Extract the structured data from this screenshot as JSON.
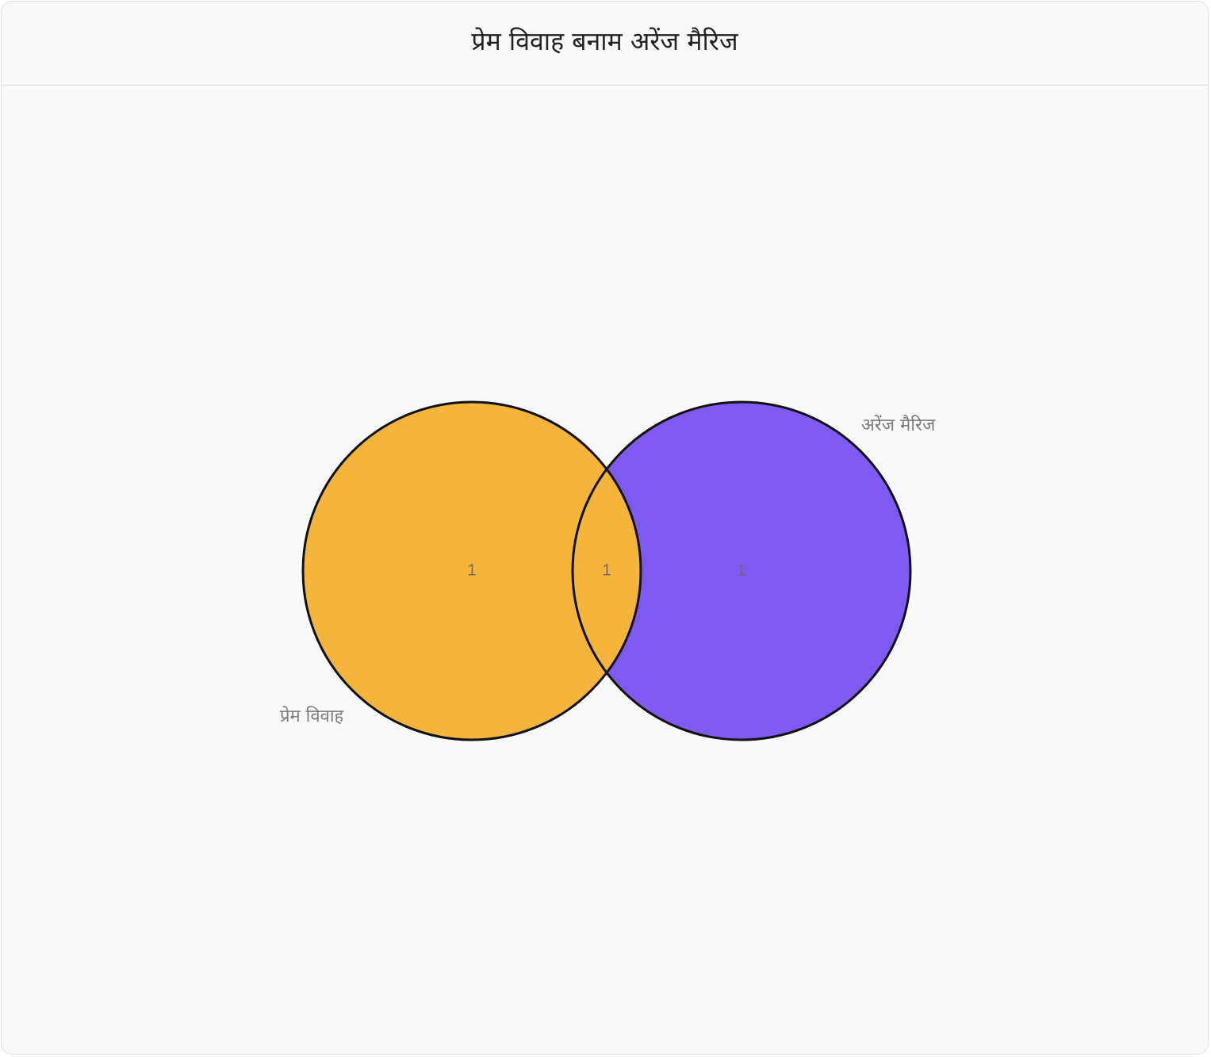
{
  "title": "प्रेम विवाह बनाम अरेंज मैरिज",
  "chart_data": {
    "type": "venn",
    "sets": [
      {
        "name": "प्रेम विवाह",
        "only_count": "1",
        "color": "#f5b43b"
      },
      {
        "name": "अरेंज मैरिज",
        "only_count": "1",
        "color": "#7f5af0"
      }
    ],
    "intersection_count": "1",
    "outline_color": "#111111",
    "label_color": "#7a7a7a"
  }
}
